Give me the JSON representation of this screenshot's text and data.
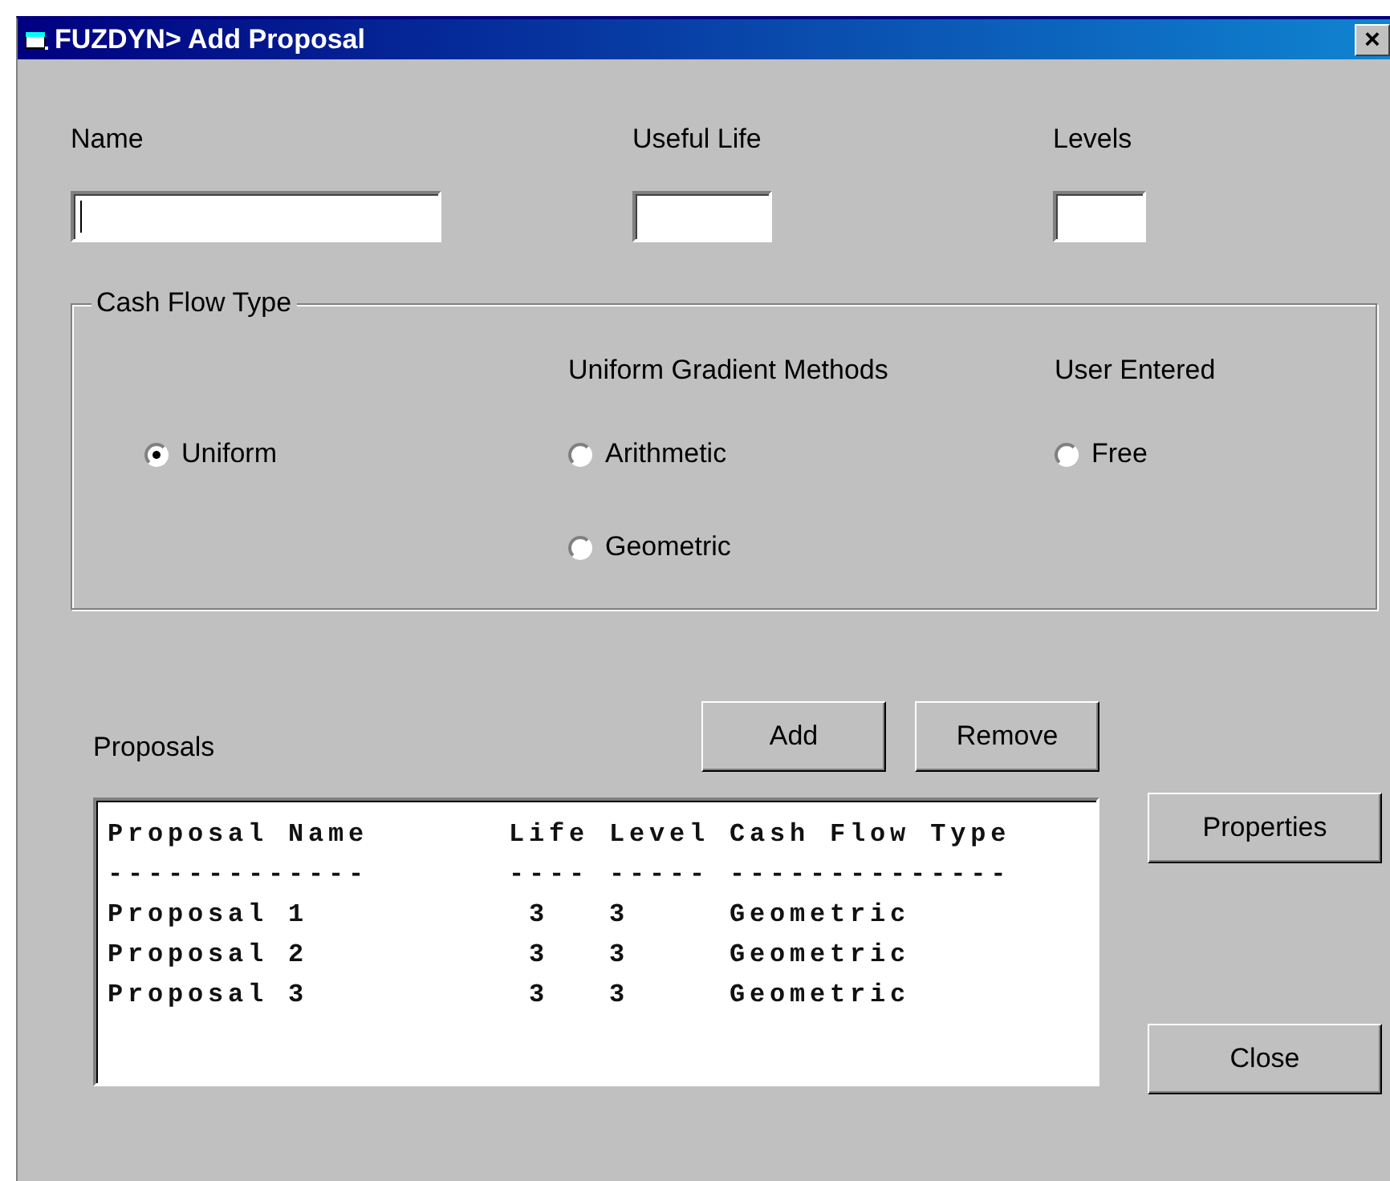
{
  "window": {
    "title": "FUZDYN> Add Proposal",
    "close_label": "×"
  },
  "fields": [
    {
      "label": "Name",
      "focused": true
    },
    {
      "label": "Useful Life",
      "focused": false
    },
    {
      "label": "Levels",
      "focused": false
    }
  ],
  "cash_flow_type": {
    "title": "Cash Flow Type",
    "columns": [
      {
        "options": [
          {
            "label": "Uniform",
            "selected": true
          }
        ]
      },
      {
        "heading": "Uniform Gradient Methods",
        "options": [
          {
            "label": "Arithmetic",
            "selected": false
          },
          {
            "label": "Geometric",
            "selected": false
          }
        ]
      },
      {
        "heading": "User Entered",
        "options": [
          {
            "label": "Free",
            "selected": false
          }
        ]
      }
    ]
  },
  "proposals": {
    "label": "Proposals",
    "buttons": [
      {
        "label": "Add"
      },
      {
        "label": "Remove"
      }
    ],
    "lines": [
      "Proposal Name       Life Level Cash Flow Type",
      "-------------       ---- ----- --------------",
      "Proposal 1           3   3     Geometric",
      "Proposal 2           3   3     Geometric",
      "Proposal 3           3   3     Geometric"
    ]
  },
  "side_buttons": [
    {
      "label": "Properties"
    },
    {
      "label": "Close"
    }
  ]
}
